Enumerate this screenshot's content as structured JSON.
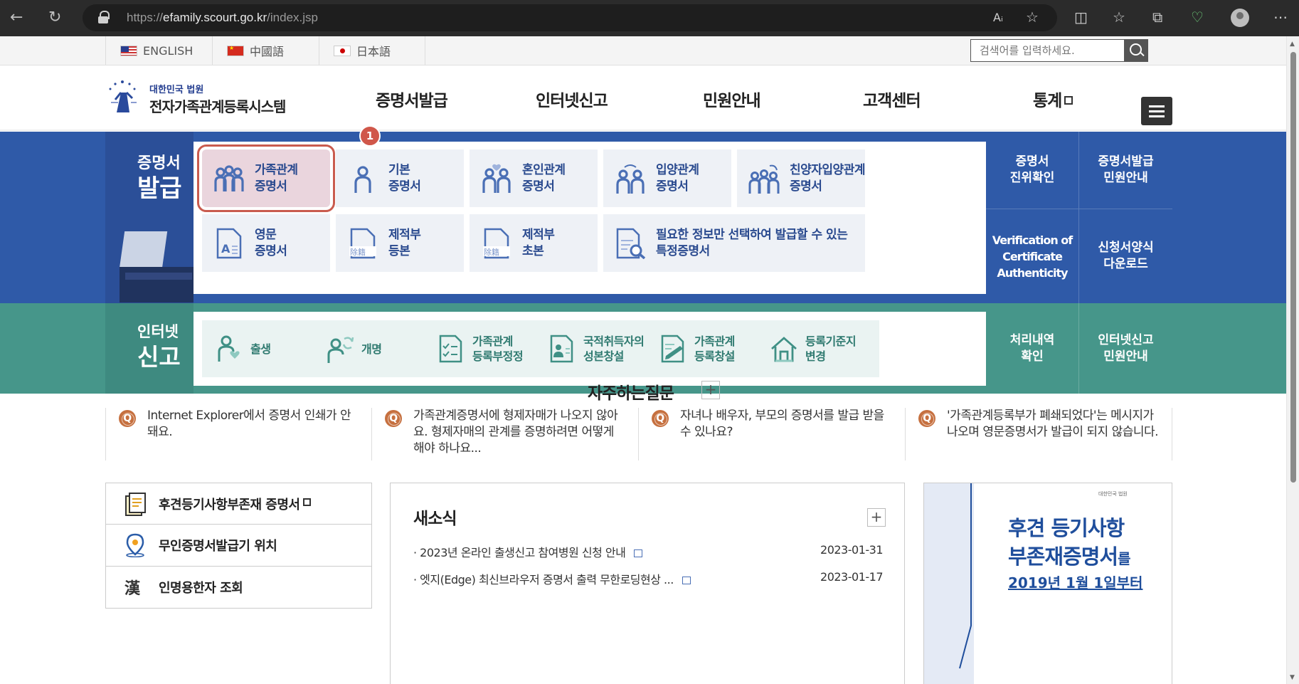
{
  "browser": {
    "url_prefix": "https://",
    "url_domain": "efamily.scourt.go.kr",
    "url_path": "/index.jsp",
    "icons": [
      "back-icon",
      "refresh-icon",
      "read-aloud-icon",
      "favorite-icon",
      "split-screen-icon",
      "favorites-icon",
      "collections-icon",
      "performance-icon",
      "profile-icon",
      "more-icon"
    ]
  },
  "langbar": {
    "languages": [
      {
        "label": "ENGLISH"
      },
      {
        "label": "中國語"
      },
      {
        "label": "日本語"
      }
    ],
    "search_placeholder": "검색어를 입력하세요."
  },
  "header": {
    "logo_sub": "대한민국 법원",
    "logo_main": "전자가족관계등록시스템",
    "nav": [
      {
        "label": "증명서발급"
      },
      {
        "label": "인터넷신고"
      },
      {
        "label": "민원안내"
      },
      {
        "label": "고객센터"
      },
      {
        "label": "통계"
      }
    ]
  },
  "cert": {
    "side_line1": "증명서",
    "side_line2": "발급",
    "badge": "1",
    "tiles": [
      {
        "label": "가족관계\n증명서",
        "icon": "family-icon"
      },
      {
        "label": "기본\n증명서",
        "icon": "person-icon"
      },
      {
        "label": "혼인관계\n증명서",
        "icon": "couple-icon"
      },
      {
        "label": "입양관계\n증명서",
        "icon": "adoption-icon"
      },
      {
        "label": "친양자입양관계\n증명서",
        "icon": "full-adoption-icon"
      },
      {
        "label": "영문\n증명서",
        "icon": "english-doc-icon"
      },
      {
        "label": "제적부\n등본",
        "icon": "removed-register-icon"
      },
      {
        "label": "제적부\n초본",
        "icon": "removed-register-excerpt-icon"
      },
      {
        "label": "필요한 정보만 선택하여 발급할 수 있는\n특정증명서",
        "icon": "doc-search-icon"
      }
    ],
    "right": [
      {
        "label": "증명서\n진위확인"
      },
      {
        "label": "증명서발급\n민원안내"
      },
      {
        "label": "Verification of\nCertificate\nAuthenticity"
      },
      {
        "label": "신청서양식\n다운로드"
      }
    ]
  },
  "report": {
    "side_line1": "인터넷",
    "side_line2": "신고",
    "tiles": [
      {
        "label": "출생",
        "icon": "birth-icon"
      },
      {
        "label": "개명",
        "icon": "rename-icon"
      },
      {
        "label": "가족관계\n등록부정정",
        "icon": "correction-icon"
      },
      {
        "label": "국적취득자의\n성본창설",
        "icon": "nationality-icon"
      },
      {
        "label": "가족관계\n등록창설",
        "icon": "registration-create-icon"
      },
      {
        "label": "등록기준지\n변경",
        "icon": "house-icon"
      }
    ],
    "right": [
      {
        "label": "처리내역\n확인"
      },
      {
        "label": "인터넷신고\n민원안내"
      }
    ]
  },
  "faq": {
    "title": "자주하는질문",
    "more": "+",
    "items": [
      {
        "text": "Internet Explorer에서 증명서 인쇄가 안돼요."
      },
      {
        "text": "가족관계증명서에 형제자매가 나오지 않아요. 형제자매의 관계를 증명하려면 어떻게 해야 하나요..."
      },
      {
        "text": "자녀나 배우자, 부모의 증명서를 발급 받을 수 있나요?"
      },
      {
        "text": "'가족관계등록부가 폐쇄되었다'는 메시지가 나오며 영문증명서가 발급이 되지 않습니다."
      }
    ]
  },
  "quick": [
    {
      "label": "후견등기사항부존재 증명서",
      "icon": "document-icon"
    },
    {
      "label": "무인증명서발급기 위치",
      "icon": "location-icon"
    },
    {
      "label": "인명용한자 조회",
      "icon": "hanja-icon"
    }
  ],
  "news": {
    "title": "새소식",
    "more": "+",
    "items": [
      {
        "title": "2023년 온라인 출생신고 참여병원 신청 안내",
        "date": "2023-01-31"
      },
      {
        "title": "엣지(Edge) 최신브라우저 증명서 출력 무한로딩현상 ...",
        "date": "2023-01-17"
      }
    ]
  },
  "banner": {
    "org": "대한민국 법원",
    "line1": "후견 등기사항",
    "line2": "부존재증명서",
    "line2_suffix": "를",
    "line3": "2019년 1월 1일부터"
  },
  "colors": {
    "cert_band": "#2f5aa8",
    "report_band": "#46968a",
    "highlight": "#c95b4e"
  }
}
